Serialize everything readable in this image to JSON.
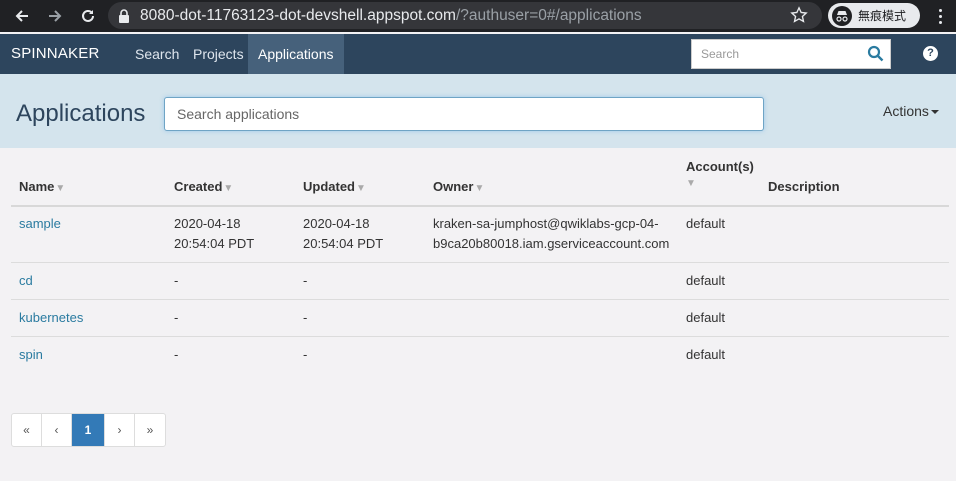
{
  "browser": {
    "url_main": "8080-dot-11763123-dot-devshell.appspot.com",
    "url_rest": "/?authuser=0#/applications",
    "incognito_label": "無痕模式"
  },
  "nav": {
    "brand": "SPINNAKER",
    "links": [
      "Search",
      "Projects",
      "Applications"
    ],
    "active": "Applications",
    "search_placeholder": "Search",
    "help": "?"
  },
  "header": {
    "title": "Applications",
    "search_placeholder": "Search applications",
    "actions_label": "Actions"
  },
  "table": {
    "columns": {
      "name": "Name",
      "created": "Created",
      "updated": "Updated",
      "owner": "Owner",
      "accounts": "Account(s)",
      "description": "Description"
    },
    "sort_glyph": "▼",
    "rows": [
      {
        "name": "sample",
        "created_date": "2020-04-18",
        "created_time": "20:54:04 PDT",
        "updated_date": "2020-04-18",
        "updated_time": "20:54:04 PDT",
        "owner_line1": "kraken-sa-jumphost@qwiklabs-gcp-04-",
        "owner_line2": "b9ca20b80018.iam.gserviceaccount.com",
        "account": "default",
        "description": ""
      },
      {
        "name": "cd",
        "created": "-",
        "updated": "-",
        "account": "default"
      },
      {
        "name": "kubernetes",
        "created": "-",
        "updated": "-",
        "account": "default"
      },
      {
        "name": "spin",
        "created": "-",
        "updated": "-",
        "account": "default"
      }
    ]
  },
  "pagination": {
    "first": "«",
    "prev": "‹",
    "current": "1",
    "next": "›",
    "last": "»"
  },
  "colors": {
    "nav_bg": "#2d455d",
    "header_bg": "#d4e4ed",
    "link": "#2a7ba0",
    "page_active": "#337ab7"
  },
  "icons": [
    "back-icon",
    "forward-icon",
    "reload-icon",
    "lock-icon",
    "star-icon",
    "incognito-icon",
    "kebab-menu-icon",
    "search-icon",
    "help-icon"
  ]
}
